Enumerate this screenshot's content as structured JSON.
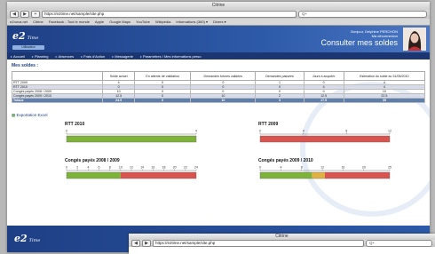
{
  "browser": {
    "window_title": "Citrine",
    "url": "https://e2time.net/sample/site.php",
    "search_placeholder": "Q+",
    "bookmarks": [
      "eZnova.net",
      "Citrine",
      "Facebook - Tout le monde",
      "Apple",
      "Google Maps",
      "YouTube",
      "Wikipédia",
      "Informations (360) ▾",
      "Divers ▾"
    ]
  },
  "header": {
    "logo": "e2",
    "logo_suffix": "Time",
    "tag": "Utilisateur",
    "greeting_line1": "Bonjour, Delphine PERCHON",
    "greeting_line2": "Ma déconnexion",
    "title": "Consulter mes soldes"
  },
  "nav": {
    "items": [
      "Accueil",
      "Planning",
      "Absences",
      "Frais d'Action",
      "Messagerie",
      "Paramètres / Mes informations perso"
    ]
  },
  "page": {
    "section_title": "Mes soldes :",
    "export_label": "Exportation Excel"
  },
  "table": {
    "headers": [
      "",
      "Solde actuel",
      "En attente de validation",
      "Demandes futures validées",
      "Demandes passées",
      "Jours à acquérir",
      "Estimation du solde au 31/05/2010"
    ],
    "rows": [
      [
        "RTT 2009",
        "4",
        "0",
        "0",
        "1",
        "0",
        "4"
      ],
      [
        "RTT 2010",
        "0",
        "0",
        "0",
        "0",
        "4",
        "4"
      ],
      [
        "Congés payés 2008 / 2009",
        "10",
        "0",
        "0",
        "0",
        "0",
        "10"
      ],
      [
        "Congés payés 2009 / 2010",
        "12.5",
        "0",
        "10",
        "2",
        "12.5",
        "22.5"
      ]
    ],
    "total": [
      "Totaux",
      "24.5",
      "0",
      "10",
      "3",
      "17.5",
      "39"
    ]
  },
  "charts": {
    "rtt2010_title": "RTT 2010",
    "rtt2009_title": "RTT 2009",
    "cp0809_title": "Congés payés 2008 / 2009",
    "cp0910_title": "Congés payés 2009 / 2010",
    "colors": {
      "green": "#7eb33a",
      "red": "#d9534f",
      "yellow": "#e0b040"
    }
  },
  "chart_data": [
    {
      "type": "bar",
      "title": "RTT 2010",
      "ticks": [
        "0",
        "4"
      ],
      "xlim": [
        0,
        4
      ],
      "segments": [
        {
          "color": "green",
          "from": 0,
          "to": 4
        }
      ]
    },
    {
      "type": "bar",
      "title": "RTT 2009",
      "ticks": [
        "0",
        "4",
        "8",
        "12"
      ],
      "xlim": [
        0,
        12
      ],
      "segments": [
        {
          "color": "red",
          "from": 0,
          "to": 12
        }
      ]
    },
    {
      "type": "bar",
      "title": "Congés payés 2008 / 2009",
      "ticks": [
        "0",
        "2",
        "4",
        "6",
        "8",
        "10",
        "12",
        "14",
        "16",
        "18",
        "20",
        "22",
        "24"
      ],
      "xlim": [
        0,
        24
      ],
      "segments": [
        {
          "color": "green",
          "from": 0,
          "to": 10
        },
        {
          "color": "red",
          "from": 10,
          "to": 24
        }
      ]
    },
    {
      "type": "bar",
      "title": "Congés payés 2009 / 2010",
      "ticks": [
        "0",
        "4",
        "8",
        "12",
        "16",
        "20",
        "25"
      ],
      "xlim": [
        0,
        25
      ],
      "segments": [
        {
          "color": "green",
          "from": 0,
          "to": 10
        },
        {
          "color": "yellow",
          "from": 10,
          "to": 12.5
        },
        {
          "color": "red",
          "from": 12.5,
          "to": 25
        }
      ]
    }
  ],
  "footer": {
    "logo": "e2",
    "logo_suffix": "Time"
  }
}
